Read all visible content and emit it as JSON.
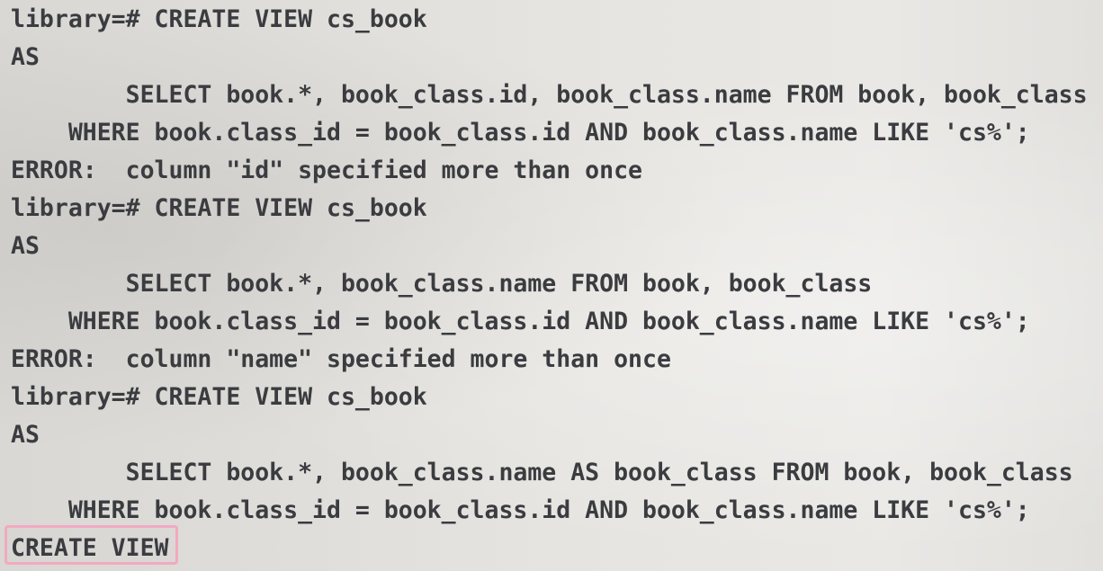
{
  "terminal": {
    "lines": [
      {
        "kind": "prompt",
        "text": "library=# CREATE VIEW cs_book"
      },
      {
        "kind": "input",
        "text": "AS"
      },
      {
        "kind": "input",
        "text": "        SELECT book.*, book_class.id, book_class.name FROM book, book_class"
      },
      {
        "kind": "input",
        "text": "    WHERE book.class_id = book_class.id AND book_class.name LIKE 'cs%';"
      },
      {
        "kind": "error",
        "text": "ERROR:  column \"id\" specified more than once"
      },
      {
        "kind": "prompt",
        "text": "library=# CREATE VIEW cs_book"
      },
      {
        "kind": "input",
        "text": "AS"
      },
      {
        "kind": "input",
        "text": "        SELECT book.*, book_class.name FROM book, book_class"
      },
      {
        "kind": "input",
        "text": "    WHERE book.class_id = book_class.id AND book_class.name LIKE 'cs%';"
      },
      {
        "kind": "error",
        "text": "ERROR:  column \"name\" specified more than once"
      },
      {
        "kind": "prompt",
        "text": "library=# CREATE VIEW cs_book"
      },
      {
        "kind": "input",
        "text": "AS"
      },
      {
        "kind": "input",
        "text": "        SELECT book.*, book_class.name AS book_class FROM book, book_class"
      },
      {
        "kind": "input",
        "text": "    WHERE book.class_id = book_class.id AND book_class.name LIKE 'cs%';"
      },
      {
        "kind": "result",
        "text": "CREATE VIEW"
      }
    ]
  },
  "colors": {
    "text": "#3a3c40",
    "highlight_border": "#f2a9c2"
  }
}
